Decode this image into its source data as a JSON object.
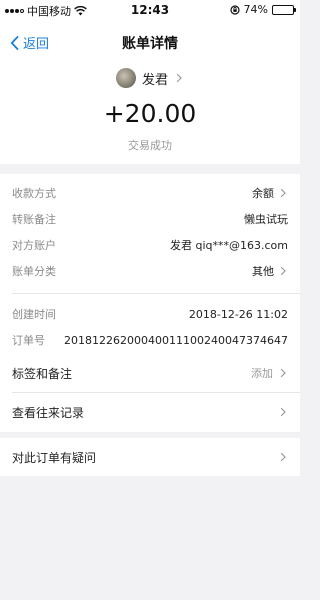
{
  "statusbar": {
    "carrier": "中国移动",
    "time": "12:43",
    "battery": "74%",
    "battery_level": 0.74
  },
  "navbar": {
    "back_label": "返回",
    "title": "账单详情"
  },
  "header": {
    "payee_name": "发君",
    "amount": "+20.00",
    "status": "交易成功"
  },
  "details": {
    "payment_method": {
      "label": "收款方式",
      "value": "余额"
    },
    "transfer_note": {
      "label": "转账备注",
      "value": "懒虫试玩"
    },
    "counterparty": {
      "label": "对方账户",
      "value": "发君 qiq***@163.com"
    },
    "category": {
      "label": "账单分类",
      "value": "其他"
    },
    "created_time": {
      "label": "创建时间",
      "value": "2018-12-26 11:02"
    },
    "order_number": {
      "label": "订单号",
      "value": "20181226200040011100240047374647"
    }
  },
  "actions": {
    "tags_notes": {
      "label": "标签和备注",
      "value": "添加"
    },
    "history": {
      "label": "查看往来记录"
    },
    "question": {
      "label": "对此订单有疑问"
    }
  }
}
